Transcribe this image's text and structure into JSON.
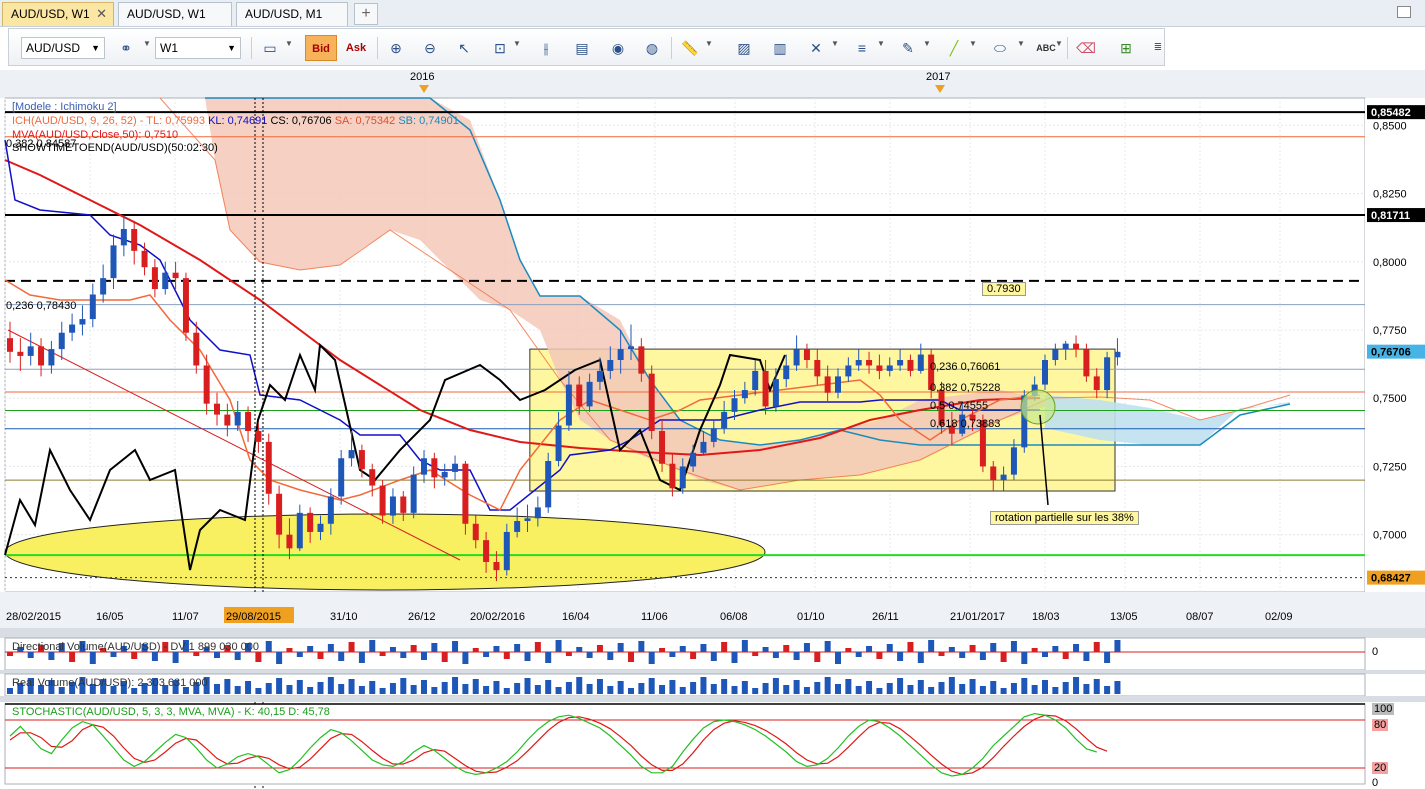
{
  "tabs": [
    {
      "label": "AUD/USD, W1"
    },
    {
      "label": "AUD/USD, W1"
    },
    {
      "label": "AUD/USD, M1"
    }
  ],
  "toolbar": {
    "symbol": "AUD/USD",
    "timeframe": "W1",
    "bid_label": "Bid",
    "ask_label": "Ask",
    "font_glyph": "ABC"
  },
  "years": [
    "2016",
    "2017"
  ],
  "legend": {
    "model": "[Modele : Ichimoku 2]",
    "ich": "ICH(AUD/USD, 9, 26, 52) -  TL: 0,75993",
    "kl": "KL: 0,74691",
    "cs": "CS: 0,76706",
    "sa": "SA: 0,75342",
    "sb": "SB: 0,74901",
    "mva": "MVA(AUD/USD,Close,50): 0,7510",
    "showtime": "SHOWTIMETOEND(AUD/USD)(50:02:30)",
    "fib_top": "0,382 0,84587"
  },
  "annotations": {
    "fib_0236_left": "0,236 0,78430",
    "level_0793": "0.7930",
    "fib_0236": "0,236 0,76061",
    "fib_0382": "0,382 0,75228",
    "fib_05": "0,5 0,74555",
    "fib_0618": "0,618 0,73883",
    "rotation": "rotation partielle sur les 38%"
  },
  "price_axis": {
    "ticks": [
      "0,8500",
      "0,8250",
      "0,8000",
      "0,7750",
      "0,7500",
      "0,7250",
      "0,7000"
    ],
    "badges": [
      {
        "text": "0,85482",
        "bg": "#000000",
        "fg": "#ffffff"
      },
      {
        "text": "0,81711",
        "bg": "#000000",
        "fg": "#ffffff"
      },
      {
        "text": "0,76706",
        "bg": "#46b4e6",
        "fg": "#000000"
      },
      {
        "text": "0,68427",
        "bg": "#f0a020",
        "fg": "#000000"
      }
    ]
  },
  "time_axis": [
    "28/02/2015",
    "16/05",
    "11/07",
    "29/08/2015",
    "31/10",
    "26/12",
    "20/02/2016",
    "16/04",
    "11/06",
    "06/08",
    "01/10",
    "26/11",
    "21/01/2017",
    "18/03",
    "13/05",
    "08/07",
    "02/09"
  ],
  "indicators": {
    "directional_volume": "Directional Volume(AUD/USD) -  DV 1 899 030 000",
    "directional_zero": "0",
    "real_volume": "Real Volume(AUD/USD): 2 303 631 000",
    "stochastic": "STOCHASTIC(AUD/USD, 5, 3, 3, MVA, MVA) -  K: 40,15  D: 45,78",
    "stoch_100": "100",
    "stoch_80": "80",
    "stoch_20": "20",
    "stoch_0": "0"
  },
  "colors": {
    "bull": "#1f57b8",
    "bear": "#d81e1e",
    "tenkan": "#f26a3a",
    "kijun": "#1010c8",
    "chikou": "#000000",
    "senkou_b": "#1a8ac0",
    "mva": "#e01818",
    "kumo_bear": "#f3c8b8",
    "kumo_bull": "#bfe0ee",
    "box": "#fff6a0",
    "ellipse": "#f8f060"
  },
  "chart_data": {
    "type": "candlestick",
    "symbol": "AUD/USD",
    "timeframe": "W1",
    "ylim": [
      0.679,
      0.86
    ],
    "x": [
      "28/02/2015",
      "07/03",
      "14/03",
      "21/03",
      "28/03",
      "04/04",
      "11/04",
      "18/04",
      "25/04",
      "02/05",
      "09/05",
      "16/05",
      "23/05",
      "30/05",
      "06/06",
      "13/06",
      "20/06",
      "27/06",
      "04/07",
      "11/07",
      "18/07",
      "25/07",
      "01/08",
      "08/08",
      "15/08",
      "22/08",
      "29/08/2015",
      "05/09",
      "12/09",
      "19/09",
      "26/09",
      "03/10",
      "10/10",
      "17/10",
      "24/10",
      "31/10",
      "07/11",
      "14/11",
      "21/11",
      "28/11",
      "05/12",
      "12/12",
      "19/12",
      "26/12",
      "02/01",
      "09/01",
      "16/01",
      "23/01",
      "30/01",
      "06/02",
      "13/02",
      "20/02/2016",
      "27/02",
      "05/03",
      "12/03",
      "19/03",
      "26/03",
      "02/04",
      "09/04",
      "16/04",
      "23/04",
      "30/04",
      "07/05",
      "14/05",
      "21/05",
      "28/05",
      "04/06",
      "11/06",
      "18/06",
      "25/06",
      "02/07",
      "09/07",
      "16/07",
      "23/07",
      "30/07",
      "06/08",
      "13/08",
      "20/08",
      "27/08",
      "03/09",
      "10/09",
      "17/09",
      "24/09",
      "01/10",
      "08/10",
      "15/10",
      "22/10",
      "29/10",
      "05/11",
      "12/11",
      "19/11",
      "26/11",
      "03/12",
      "10/12",
      "17/12",
      "24/12",
      "31/12",
      "07/01",
      "14/01",
      "21/01/2017",
      "28/01",
      "04/02",
      "11/02",
      "18/02",
      "25/02",
      "04/03",
      "11/03",
      "18/03"
    ],
    "ohlc": {
      "open": [
        0.772,
        0.767,
        0.7655,
        0.769,
        0.762,
        0.768,
        0.774,
        0.777,
        0.779,
        0.788,
        0.794,
        0.806,
        0.812,
        0.804,
        0.798,
        0.79,
        0.796,
        0.794,
        0.774,
        0.762,
        0.748,
        0.744,
        0.74,
        0.745,
        0.738,
        0.734,
        0.715,
        0.7,
        0.695,
        0.708,
        0.701,
        0.704,
        0.714,
        0.728,
        0.731,
        0.724,
        0.718,
        0.707,
        0.714,
        0.708,
        0.722,
        0.728,
        0.721,
        0.723,
        0.726,
        0.704,
        0.698,
        0.69,
        0.687,
        0.701,
        0.705,
        0.706,
        0.71,
        0.727,
        0.74,
        0.755,
        0.747,
        0.756,
        0.76,
        0.764,
        0.768,
        0.769,
        0.759,
        0.738,
        0.726,
        0.717,
        0.725,
        0.73,
        0.734,
        0.739,
        0.745,
        0.75,
        0.753,
        0.76,
        0.747,
        0.757,
        0.762,
        0.768,
        0.764,
        0.758,
        0.752,
        0.758,
        0.762,
        0.764,
        0.762,
        0.76,
        0.762,
        0.764,
        0.76,
        0.766,
        0.753,
        0.74,
        0.737,
        0.744,
        0.742,
        0.725,
        0.72,
        0.722,
        0.732,
        0.751,
        0.755,
        0.764,
        0.768,
        0.77,
        0.768,
        0.758,
        0.753,
        0.765
      ],
      "close": [
        0.767,
        0.7655,
        0.769,
        0.762,
        0.768,
        0.774,
        0.777,
        0.779,
        0.788,
        0.794,
        0.806,
        0.812,
        0.804,
        0.798,
        0.79,
        0.796,
        0.794,
        0.774,
        0.762,
        0.748,
        0.744,
        0.74,
        0.745,
        0.738,
        0.734,
        0.715,
        0.7,
        0.695,
        0.708,
        0.701,
        0.704,
        0.714,
        0.728,
        0.731,
        0.724,
        0.718,
        0.707,
        0.714,
        0.708,
        0.722,
        0.728,
        0.721,
        0.723,
        0.726,
        0.704,
        0.698,
        0.69,
        0.687,
        0.701,
        0.705,
        0.706,
        0.71,
        0.727,
        0.74,
        0.755,
        0.747,
        0.756,
        0.76,
        0.764,
        0.768,
        0.769,
        0.759,
        0.738,
        0.726,
        0.717,
        0.725,
        0.73,
        0.734,
        0.739,
        0.745,
        0.75,
        0.753,
        0.76,
        0.747,
        0.757,
        0.762,
        0.768,
        0.764,
        0.758,
        0.752,
        0.758,
        0.762,
        0.764,
        0.762,
        0.76,
        0.762,
        0.764,
        0.76,
        0.766,
        0.753,
        0.74,
        0.737,
        0.744,
        0.742,
        0.725,
        0.72,
        0.722,
        0.732,
        0.751,
        0.755,
        0.764,
        0.768,
        0.77,
        0.768,
        0.758,
        0.753,
        0.765,
        0.767
      ],
      "high": [
        0.778,
        0.772,
        0.774,
        0.772,
        0.771,
        0.778,
        0.781,
        0.784,
        0.792,
        0.799,
        0.81,
        0.817,
        0.815,
        0.807,
        0.801,
        0.8,
        0.8,
        0.796,
        0.778,
        0.766,
        0.752,
        0.748,
        0.749,
        0.747,
        0.741,
        0.737,
        0.718,
        0.706,
        0.711,
        0.71,
        0.707,
        0.717,
        0.731,
        0.738,
        0.733,
        0.726,
        0.72,
        0.717,
        0.716,
        0.725,
        0.731,
        0.73,
        0.726,
        0.729,
        0.727,
        0.707,
        0.701,
        0.694,
        0.704,
        0.71,
        0.711,
        0.714,
        0.73,
        0.745,
        0.76,
        0.758,
        0.759,
        0.765,
        0.769,
        0.775,
        0.777,
        0.772,
        0.762,
        0.742,
        0.73,
        0.728,
        0.733,
        0.738,
        0.742,
        0.749,
        0.753,
        0.756,
        0.764,
        0.764,
        0.761,
        0.766,
        0.773,
        0.77,
        0.768,
        0.762,
        0.761,
        0.765,
        0.768,
        0.767,
        0.766,
        0.765,
        0.768,
        0.766,
        0.77,
        0.768,
        0.756,
        0.745,
        0.748,
        0.746,
        0.744,
        0.727,
        0.725,
        0.735,
        0.753,
        0.758,
        0.766,
        0.77,
        0.771,
        0.773,
        0.77,
        0.761,
        0.767,
        0.772
      ],
      "low": [
        0.763,
        0.76,
        0.762,
        0.758,
        0.759,
        0.764,
        0.771,
        0.773,
        0.776,
        0.785,
        0.79,
        0.802,
        0.799,
        0.795,
        0.787,
        0.788,
        0.79,
        0.771,
        0.759,
        0.744,
        0.74,
        0.736,
        0.738,
        0.734,
        0.73,
        0.711,
        0.695,
        0.691,
        0.694,
        0.697,
        0.698,
        0.7,
        0.711,
        0.725,
        0.721,
        0.714,
        0.704,
        0.704,
        0.705,
        0.706,
        0.719,
        0.717,
        0.718,
        0.72,
        0.7,
        0.695,
        0.686,
        0.683,
        0.685,
        0.699,
        0.701,
        0.703,
        0.708,
        0.725,
        0.738,
        0.744,
        0.745,
        0.753,
        0.757,
        0.759,
        0.764,
        0.756,
        0.735,
        0.723,
        0.714,
        0.715,
        0.723,
        0.729,
        0.732,
        0.737,
        0.742,
        0.748,
        0.751,
        0.744,
        0.745,
        0.754,
        0.76,
        0.761,
        0.755,
        0.749,
        0.75,
        0.756,
        0.76,
        0.759,
        0.757,
        0.758,
        0.76,
        0.758,
        0.759,
        0.75,
        0.737,
        0.733,
        0.736,
        0.738,
        0.723,
        0.716,
        0.716,
        0.72,
        0.73,
        0.749,
        0.753,
        0.762,
        0.764,
        0.765,
        0.756,
        0.75,
        0.75,
        0.762
      ]
    },
    "horizontal_levels": [
      0.85482,
      0.8458,
      0.81711,
      0.793,
      0.7843,
      0.7606,
      0.7523,
      0.7455,
      0.7388,
      0.72,
      0.6925,
      0.68427
    ],
    "box": {
      "x_start": "20/02/2016",
      "x_end": "13/05",
      "y_low": 0.716,
      "y_high": 0.768
    }
  },
  "stochastic_data": {
    "ylim": [
      0,
      100
    ],
    "k": [
      60,
      72,
      58,
      44,
      38,
      55,
      70,
      78,
      74,
      60,
      45,
      30,
      22,
      28,
      40,
      52,
      62,
      58,
      45,
      30,
      20,
      25,
      34,
      38,
      34,
      24,
      14,
      18,
      30,
      45,
      58,
      68,
      64,
      54,
      42,
      30,
      24,
      22,
      28,
      40,
      48,
      42,
      32,
      22,
      15,
      12,
      14,
      20,
      28,
      40,
      55,
      68,
      78,
      84,
      86,
      82,
      76,
      70,
      60,
      48,
      36,
      22,
      14,
      14,
      22,
      40,
      56,
      70,
      78,
      80,
      78,
      74,
      68,
      60,
      50,
      40,
      28,
      22,
      24,
      32,
      45,
      60,
      72,
      80,
      78,
      70,
      60,
      48,
      36,
      24,
      14,
      10,
      12,
      20,
      32,
      48,
      60,
      72,
      84,
      88,
      86,
      80,
      70,
      56,
      44,
      40
    ],
    "d": [
      55,
      64,
      64,
      58,
      47,
      46,
      54,
      68,
      74,
      71,
      60,
      45,
      32,
      27,
      30,
      40,
      51,
      57,
      55,
      44,
      32,
      25,
      26,
      32,
      35,
      32,
      24,
      19,
      21,
      31,
      44,
      57,
      63,
      62,
      53,
      42,
      32,
      25,
      25,
      30,
      39,
      43,
      41,
      32,
      23,
      16,
      14,
      15,
      21,
      29,
      41,
      54,
      67,
      77,
      83,
      84,
      81,
      76,
      69,
      59,
      48,
      35,
      24,
      17,
      17,
      25,
      39,
      55,
      68,
      76,
      79,
      77,
      73,
      67,
      59,
      50,
      39,
      30,
      25,
      26,
      34,
      46,
      59,
      71,
      77,
      76,
      69,
      59,
      48,
      36,
      25,
      16,
      12,
      14,
      21,
      33,
      47,
      60,
      72,
      81,
      86,
      85,
      79,
      69,
      57,
      46,
      41
    ]
  }
}
